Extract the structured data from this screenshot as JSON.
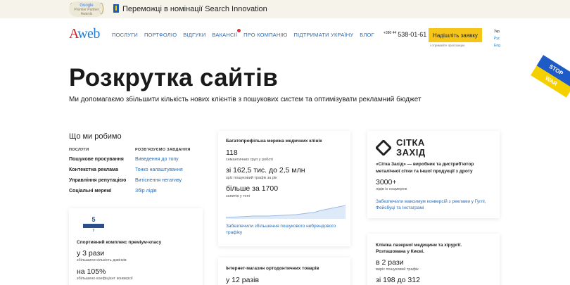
{
  "banner": {
    "badge_brand": "Google",
    "badge_lines": "Premier Partner Awards",
    "text": "Переможці в номінації Search Innovation"
  },
  "header": {
    "logo_a": "A",
    "logo_rest": "web",
    "nav": [
      "ПОСЛУГИ",
      "ПОРТФОЛІО",
      "ВІДГУКИ",
      "ВАКАНСІЇ",
      "ПРО КОМПАНІЮ",
      "ПІДТРИМАТИ УКРАЇНУ",
      "БЛОГ"
    ],
    "phone_prefix": "+380 44",
    "phone": "538-01-61",
    "cta": "Надішліть заявку",
    "cta_note": "і отримайте пропозицію",
    "langs": [
      "Укр",
      "Рус",
      "Eng"
    ]
  },
  "ribbon": {
    "top": "STOP",
    "bottom": "WAR"
  },
  "hero": {
    "title": "Розкрутка сайтів",
    "lead": "Ми допомагаємо збільшити кількість нових клієнтів з пошукових систем та оптимізувати рекламний бюджет"
  },
  "what": {
    "title": "Що ми робимо",
    "col_services": "ПОСЛУГИ",
    "col_tasks": "РОЗВ'ЯЗУЄМО ЗАВДАННЯ",
    "services": [
      "Пошукове просування",
      "Контекстна реклама",
      "Управління репутацією",
      "Соціальні мережі"
    ],
    "tasks": [
      "Виведення до топу",
      "Тонко налаштування",
      "Витіснення негативу",
      "Збір лідів"
    ]
  },
  "cards": {
    "sport": {
      "logo_num": "5",
      "logo_sub": "у",
      "title": "Спортивний комплекс преміум-класу",
      "n1": "у 3 рази",
      "c1": "збільшили кількість дзвінків",
      "n2": "на 105%",
      "c2": "збільшено коефіцієнт конверсії"
    },
    "medical": {
      "title": "Багатопрофільна мережа медичних клінік",
      "n1": "118",
      "c1": "семантичних груп у роботі",
      "n2": "зі 162,5 тис. до 2,5 млн",
      "c2": "зріс пошуковий трафік за рік",
      "n3": "більше за 1700",
      "c3": "запитів у топі",
      "link1": "Забезпечили збільшення пошукового небрендового",
      "link2": "трафіку"
    },
    "shop": {
      "title": "Інтернет-магазин ортодонтичних товарів",
      "n1": "у  12 разів"
    },
    "sitka": {
      "logo_l1": "СІТКА",
      "logo_l2": "ЗАХІД",
      "d1": "«Сітка Захід» — виробник та дистриб'ютор",
      "d2": "металічної сітки та іншої продукції з дроту",
      "n1": "3000+",
      "c1": "лідів із соцмереж",
      "link1": "Забезпечили максимум конверсій з реклами у Гуглі,",
      "link2": "Фейсбуці та Інстаграмі"
    },
    "clinic": {
      "t1": "Клініка лазерної медицини та хірургії.",
      "t2": "Розташована у Києві.",
      "n1": "в 2 рази",
      "c1": "виріс пошуковий трафік",
      "n2": "зі 198 до 312"
    }
  },
  "colors": {
    "accent_blue": "#2a6db8",
    "logo_red": "#c8232c",
    "cta_yellow": "#f5c518"
  }
}
